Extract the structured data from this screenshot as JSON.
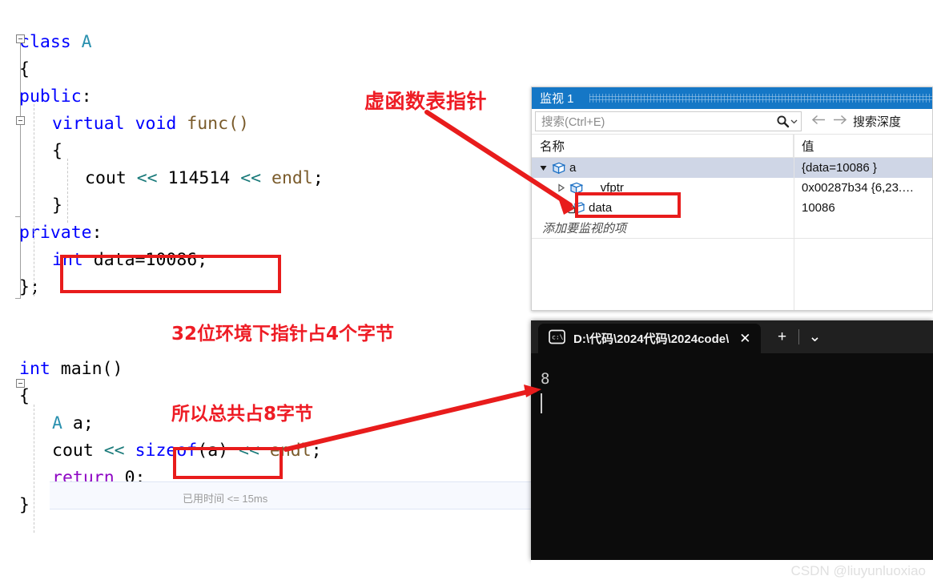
{
  "editor": {
    "lines": [
      {
        "indent": 0,
        "tokens": [
          {
            "t": "class ",
            "c": "kw"
          },
          {
            "t": "A",
            "c": "type"
          }
        ]
      },
      {
        "indent": 0,
        "tokens": [
          {
            "t": "{",
            "c": "num"
          }
        ]
      },
      {
        "indent": 0,
        "tokens": [
          {
            "t": "public",
            "c": "kw"
          },
          {
            "t": ":",
            "c": "num"
          }
        ]
      },
      {
        "indent": 1,
        "tokens": [
          {
            "t": "virtual ",
            "c": "kw"
          },
          {
            "t": "void ",
            "c": "kw"
          },
          {
            "t": "func()",
            "c": "fn"
          }
        ]
      },
      {
        "indent": 1,
        "tokens": [
          {
            "t": "{",
            "c": "num"
          }
        ]
      },
      {
        "indent": 2,
        "tokens": [
          {
            "t": "cout ",
            "c": "num"
          },
          {
            "t": "<< ",
            "c": "op"
          },
          {
            "t": "114514 ",
            "c": "num"
          },
          {
            "t": "<< ",
            "c": "op"
          },
          {
            "t": "endl",
            "c": "fn"
          },
          {
            "t": ";",
            "c": "num"
          }
        ]
      },
      {
        "indent": 1,
        "tokens": [
          {
            "t": "}",
            "c": "num"
          }
        ]
      },
      {
        "indent": 0,
        "tokens": [
          {
            "t": "private",
            "c": "kw"
          },
          {
            "t": ":",
            "c": "num"
          }
        ]
      },
      {
        "indent": 1,
        "tokens": [
          {
            "t": "int ",
            "c": "kw"
          },
          {
            "t": "data=10086;",
            "c": "num"
          }
        ]
      },
      {
        "indent": 0,
        "tokens": [
          {
            "t": "};",
            "c": "num"
          }
        ]
      },
      {
        "indent": 0,
        "tokens": []
      },
      {
        "indent": 0,
        "tokens": []
      },
      {
        "indent": 0,
        "tokens": [
          {
            "t": "int ",
            "c": "kw"
          },
          {
            "t": "main()",
            "c": "num"
          }
        ]
      },
      {
        "indent": 0,
        "tokens": [
          {
            "t": "{",
            "c": "num"
          }
        ]
      },
      {
        "indent": 1,
        "tokens": [
          {
            "t": "A ",
            "c": "type"
          },
          {
            "t": "a;",
            "c": "num"
          }
        ]
      },
      {
        "indent": 1,
        "tokens": [
          {
            "t": "cout ",
            "c": "num"
          },
          {
            "t": "<< ",
            "c": "op"
          },
          {
            "t": "sizeof",
            "c": "kw"
          },
          {
            "t": "(a) ",
            "c": "num"
          },
          {
            "t": "<< ",
            "c": "op"
          },
          {
            "t": "endl",
            "c": "fn"
          },
          {
            "t": ";",
            "c": "num"
          }
        ]
      },
      {
        "indent": 1,
        "tokens": [
          {
            "t": "return ",
            "c": "ctrl"
          },
          {
            "t": "0;",
            "c": "num"
          }
        ]
      },
      {
        "indent": 0,
        "tokens": [
          {
            "t": "}",
            "c": "num"
          }
        ]
      }
    ],
    "elapsed_time": "已用时间 <= 15ms"
  },
  "annotations": {
    "vfptr_label": "虚函数表指针",
    "pointer_size_note": "32位环境下指针占4个字节",
    "total_size_note": "所以总共占8字节",
    "accent_color": "#ee1c25"
  },
  "watch_window": {
    "title": "监视 1",
    "search_placeholder": "搜索(Ctrl+E)",
    "search_value": "搜索(Ctrl+E)",
    "depth_label": "搜索深度",
    "columns": {
      "name": "名称",
      "value": "值"
    },
    "rows": [
      {
        "name": "a",
        "value": "{data=10086 }",
        "icon": "object-box-icon",
        "expander": "expanded",
        "depth": 0,
        "selected": true
      },
      {
        "name": "__vfptr",
        "value": "0x00287b34 {6,23.…",
        "icon": "object-box-icon",
        "expander": "collapsed",
        "depth": 1,
        "selected": false
      },
      {
        "name": "data",
        "value": "10086",
        "icon": "private-member-icon",
        "expander": "none",
        "depth": 1,
        "selected": false
      }
    ],
    "add_item_text": "添加要监视的项",
    "title_bar_color": "#1577c6"
  },
  "terminal": {
    "tab_title": "D:\\代码\\2024代码\\2024code\\",
    "tab_icon": "console-icon",
    "close_label": "✕",
    "new_tab_label": "+",
    "dropdown_label": "⌄",
    "output": "8"
  },
  "watermark": "CSDN @liuyunluoxiao"
}
